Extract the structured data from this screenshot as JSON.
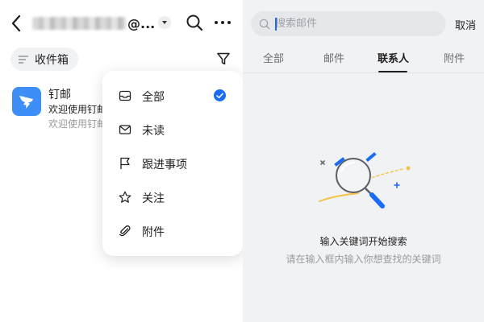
{
  "left_panel": {
    "account": {
      "email_suffix": "@..."
    },
    "folder": {
      "label": "收件箱"
    },
    "mail_list": [
      {
        "sender": "钉邮",
        "subject": "欢迎使用钉邮",
        "preview": "欢迎使用钉邮"
      }
    ],
    "filter_menu": {
      "items": [
        {
          "label": "全部",
          "icon": "inbox-icon",
          "selected": true
        },
        {
          "label": "未读",
          "icon": "envelope-icon",
          "selected": false
        },
        {
          "label": "跟进事项",
          "icon": "flag-icon",
          "selected": false
        },
        {
          "label": "关注",
          "icon": "star-icon",
          "selected": false
        },
        {
          "label": "附件",
          "icon": "paperclip-icon",
          "selected": false
        }
      ]
    }
  },
  "right_panel": {
    "search": {
      "placeholder": "搜索邮件",
      "value": ""
    },
    "cancel_label": "取消",
    "tabs": [
      {
        "label": "全部",
        "active": false
      },
      {
        "label": "邮件",
        "active": false
      },
      {
        "label": "联系人",
        "active": true
      },
      {
        "label": "附件",
        "active": false
      }
    ],
    "empty_state": {
      "title": "输入关键词开始搜索",
      "subtitle": "请在输入框内输入你想查找的关键词"
    }
  },
  "colors": {
    "accent": "#1a6cf5",
    "app_icon_bg": "#3d8ef7",
    "right_bg": "#f1f2f4",
    "illustration_yellow": "#f6c246"
  }
}
